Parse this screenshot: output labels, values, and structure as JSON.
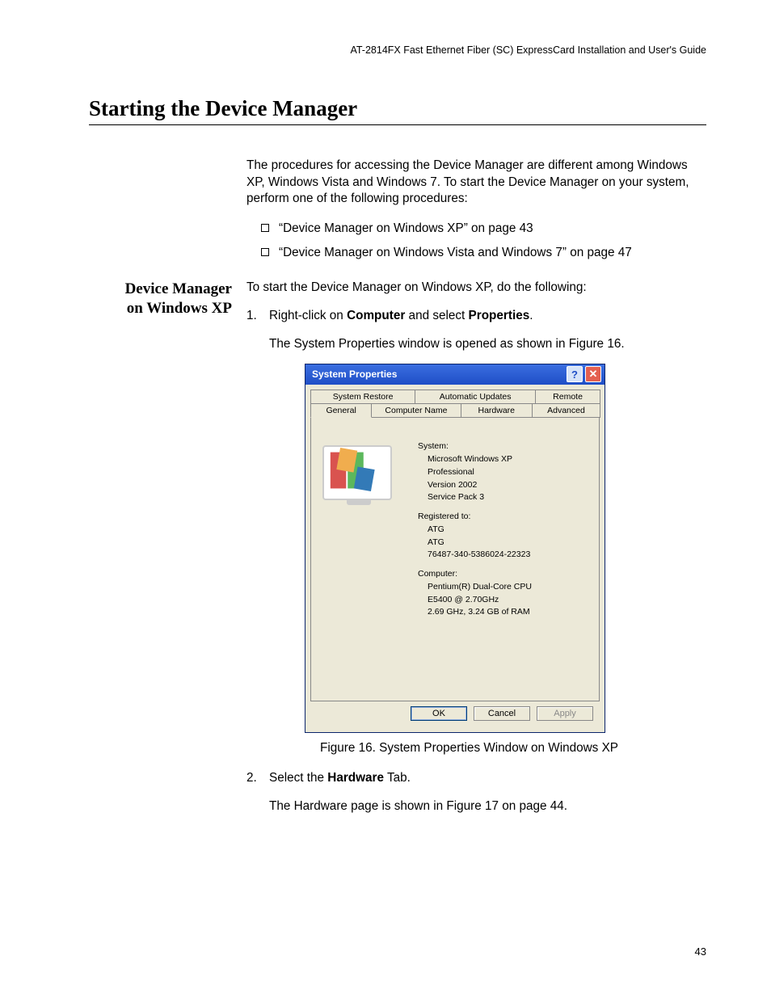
{
  "running_head": "AT-2814FX Fast Ethernet Fiber (SC) ExpressCard Installation and User's Guide",
  "heading": "Starting the Device Manager",
  "intro": "The procedures for accessing the Device Manager are different among Windows XP, Windows Vista and Windows 7. To start the Device Manager on your system, perform one of the following procedures:",
  "bullets": [
    "“Device Manager on Windows XP” on page 43",
    "“Device Manager on Windows Vista and Windows 7” on page 47"
  ],
  "side_heading_l1": "Device Manager",
  "side_heading_l2": "on Windows XP",
  "lead_in": "To start the Device Manager on Windows XP, do the following:",
  "step1_num": "1.",
  "step1_a": "Right-click on ",
  "step1_b": "Computer",
  "step1_c": " and select ",
  "step1_d": "Properties",
  "step1_e": ".",
  "step1_result": "The System Properties window is opened as shown in Figure 16.",
  "fig_caption": "Figure 16. System Properties Window on Windows XP",
  "step2_num": "2.",
  "step2_a": "Select the ",
  "step2_b": "Hardware",
  "step2_c": " Tab.",
  "step2_result": "The Hardware page is shown in Figure 17 on page 44.",
  "page_number": "43",
  "xp": {
    "title": "System Properties",
    "help_glyph": "?",
    "close_glyph": "✕",
    "tabs_row1": [
      "System Restore",
      "Automatic Updates",
      "Remote"
    ],
    "tabs_row2": [
      "General",
      "Computer Name",
      "Hardware",
      "Advanced"
    ],
    "system_label": "System:",
    "system_lines": [
      "Microsoft Windows XP",
      "Professional",
      "Version 2002",
      "Service Pack 3"
    ],
    "registered_label": "Registered to:",
    "registered_lines": [
      "ATG",
      "ATG",
      "76487-340-5386024-22323"
    ],
    "computer_label": "Computer:",
    "computer_lines": [
      "Pentium(R) Dual-Core  CPU",
      "E5400  @ 2.70GHz",
      "2.69 GHz, 3.24 GB of RAM"
    ],
    "ok": "OK",
    "cancel": "Cancel",
    "apply": "Apply"
  }
}
